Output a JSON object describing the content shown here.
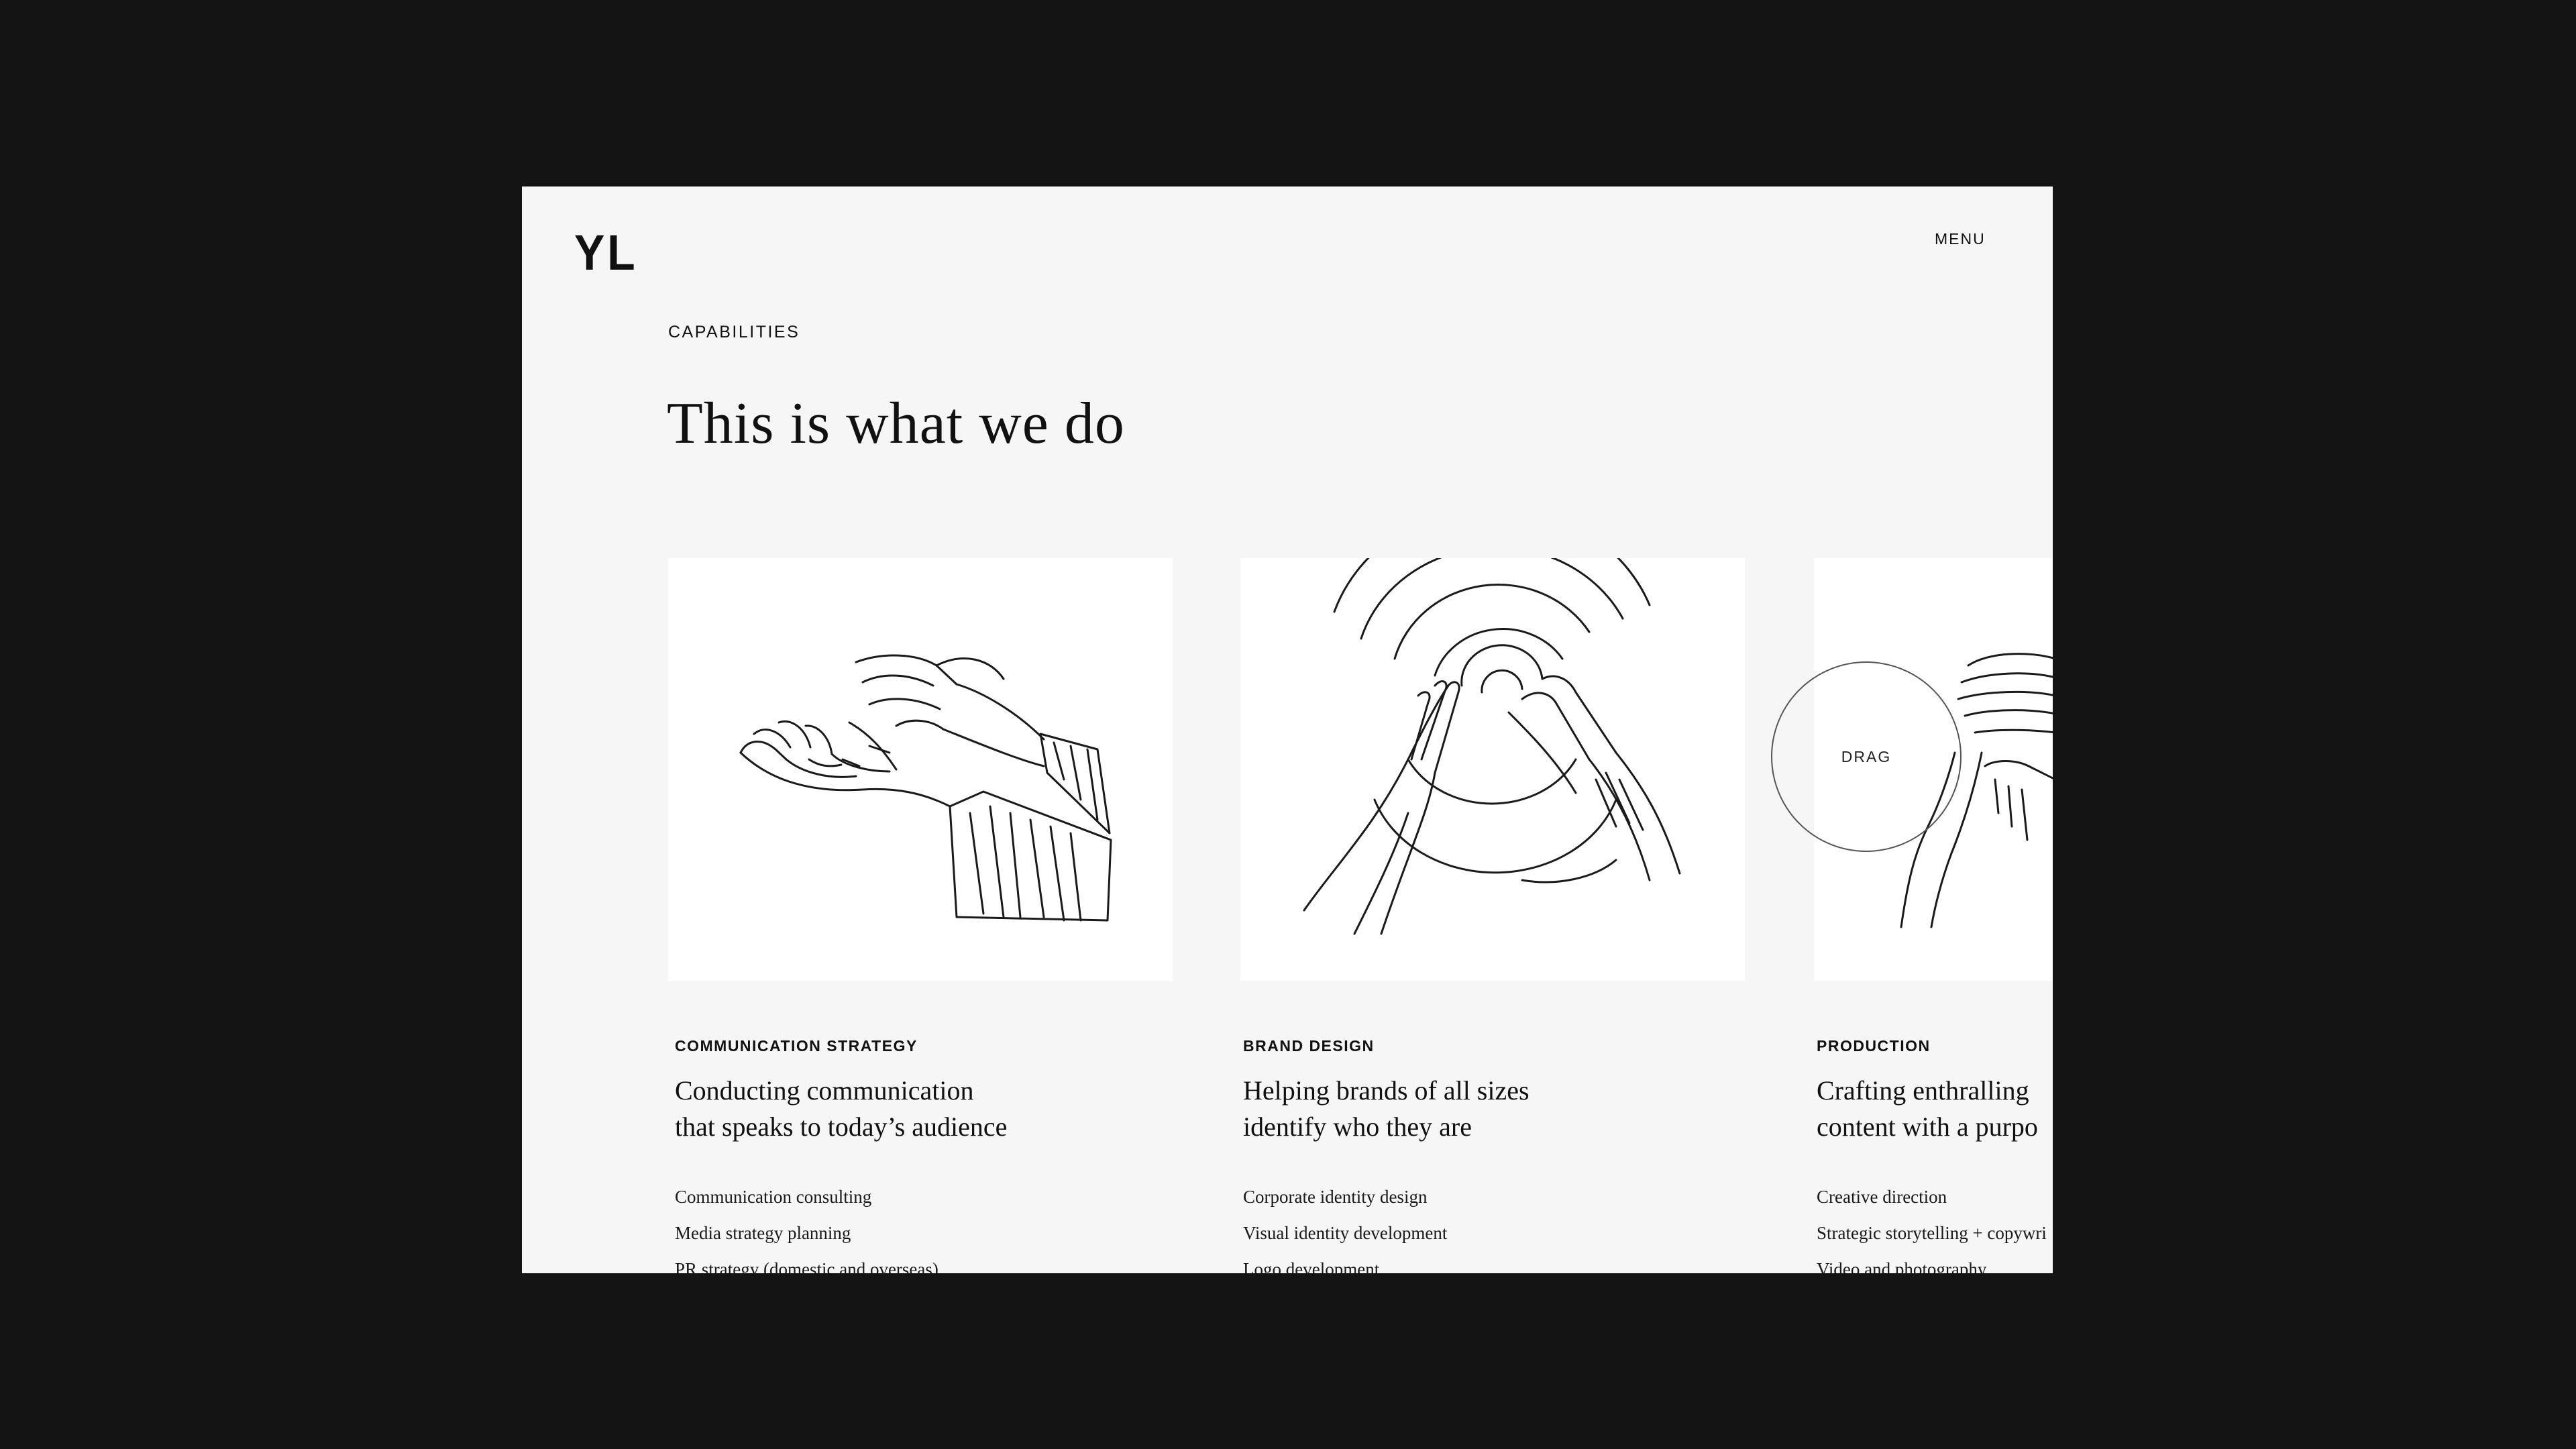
{
  "header": {
    "logo": "YL",
    "menu_label": "MENU"
  },
  "section": {
    "eyebrow": "CAPABILITIES",
    "title": "This is what we do"
  },
  "cards": [
    {
      "category": "COMMUNICATION STRATEGY",
      "headline": [
        "Conducting communication",
        "that speaks to today’s audience"
      ],
      "items": [
        "Communication consulting",
        "Media strategy planning",
        "PR strategy (domestic and overseas)"
      ],
      "illustration": "open-hands-illustration"
    },
    {
      "category": "BRAND DESIGN",
      "headline": [
        "Helping brands of all sizes",
        "identify who they are"
      ],
      "items": [
        "Corporate identity design",
        "Visual identity development",
        "Logo development"
      ],
      "illustration": "hands-ripple-illustration"
    },
    {
      "category": "PRODUCTION",
      "headline": [
        "Crafting enthralling",
        "content with a purpo"
      ],
      "items": [
        "Creative direction",
        "Strategic storytelling + copywri",
        "Video and photography"
      ],
      "illustration": "hands-stack-illustration"
    }
  ],
  "drag_cursor": {
    "label": "DRAG"
  }
}
